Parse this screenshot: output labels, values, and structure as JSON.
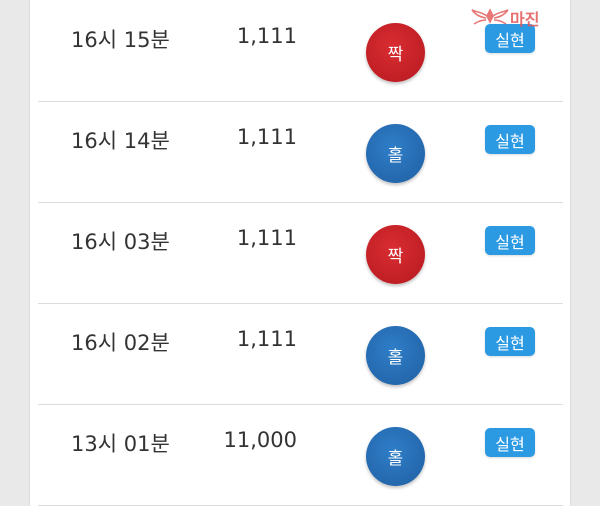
{
  "watermark": {
    "text": "마진",
    "colors": {
      "primary": "#e25555"
    }
  },
  "colors": {
    "even": "#c01f25",
    "odd": "#2468ad",
    "badge": "#2b9ae3"
  },
  "rows": [
    {
      "time": "16시 15분",
      "amount": "1,111",
      "result": "짝",
      "result_color": "red",
      "status": "실현"
    },
    {
      "time": "16시 14분",
      "amount": "1,111",
      "result": "홀",
      "result_color": "blue",
      "status": "실현"
    },
    {
      "time": "16시 03분",
      "amount": "1,111",
      "result": "짝",
      "result_color": "red",
      "status": "실현"
    },
    {
      "time": "16시 02분",
      "amount": "1,111",
      "result": "홀",
      "result_color": "blue",
      "status": "실현"
    },
    {
      "time": "13시 01분",
      "amount": "11,000",
      "result": "홀",
      "result_color": "blue",
      "status": "실현"
    }
  ]
}
